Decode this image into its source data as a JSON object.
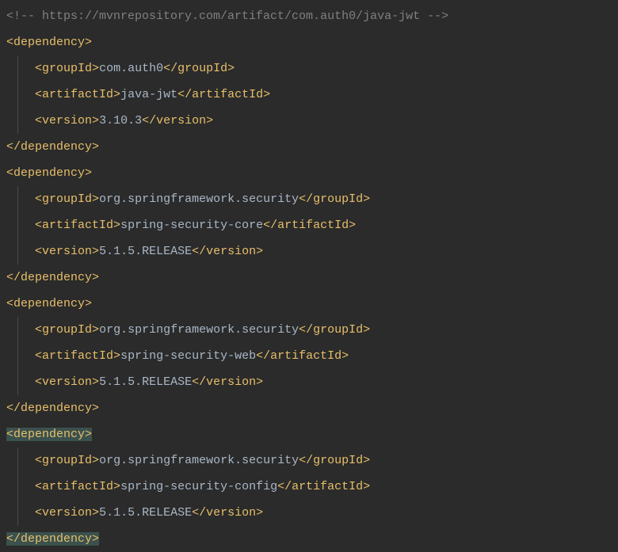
{
  "comment": "<!-- https://mvnrepository.com/artifact/com.auth0/java-jwt -->",
  "dependencies": [
    {
      "groupId": "com.auth0",
      "artifactId": "java-jwt",
      "version": "3.10.3",
      "highlighted": false
    },
    {
      "groupId": "org.springframework.security",
      "artifactId": "spring-security-core",
      "version": "5.1.5.RELEASE",
      "highlighted": false
    },
    {
      "groupId": "org.springframework.security",
      "artifactId": "spring-security-web",
      "version": "5.1.5.RELEASE",
      "highlighted": false
    },
    {
      "groupId": "org.springframework.security",
      "artifactId": "spring-security-config",
      "version": "5.1.5.RELEASE",
      "highlighted": true
    }
  ],
  "tags": {
    "dependency": "dependency",
    "groupId": "groupId",
    "artifactId": "artifactId",
    "version": "version"
  }
}
